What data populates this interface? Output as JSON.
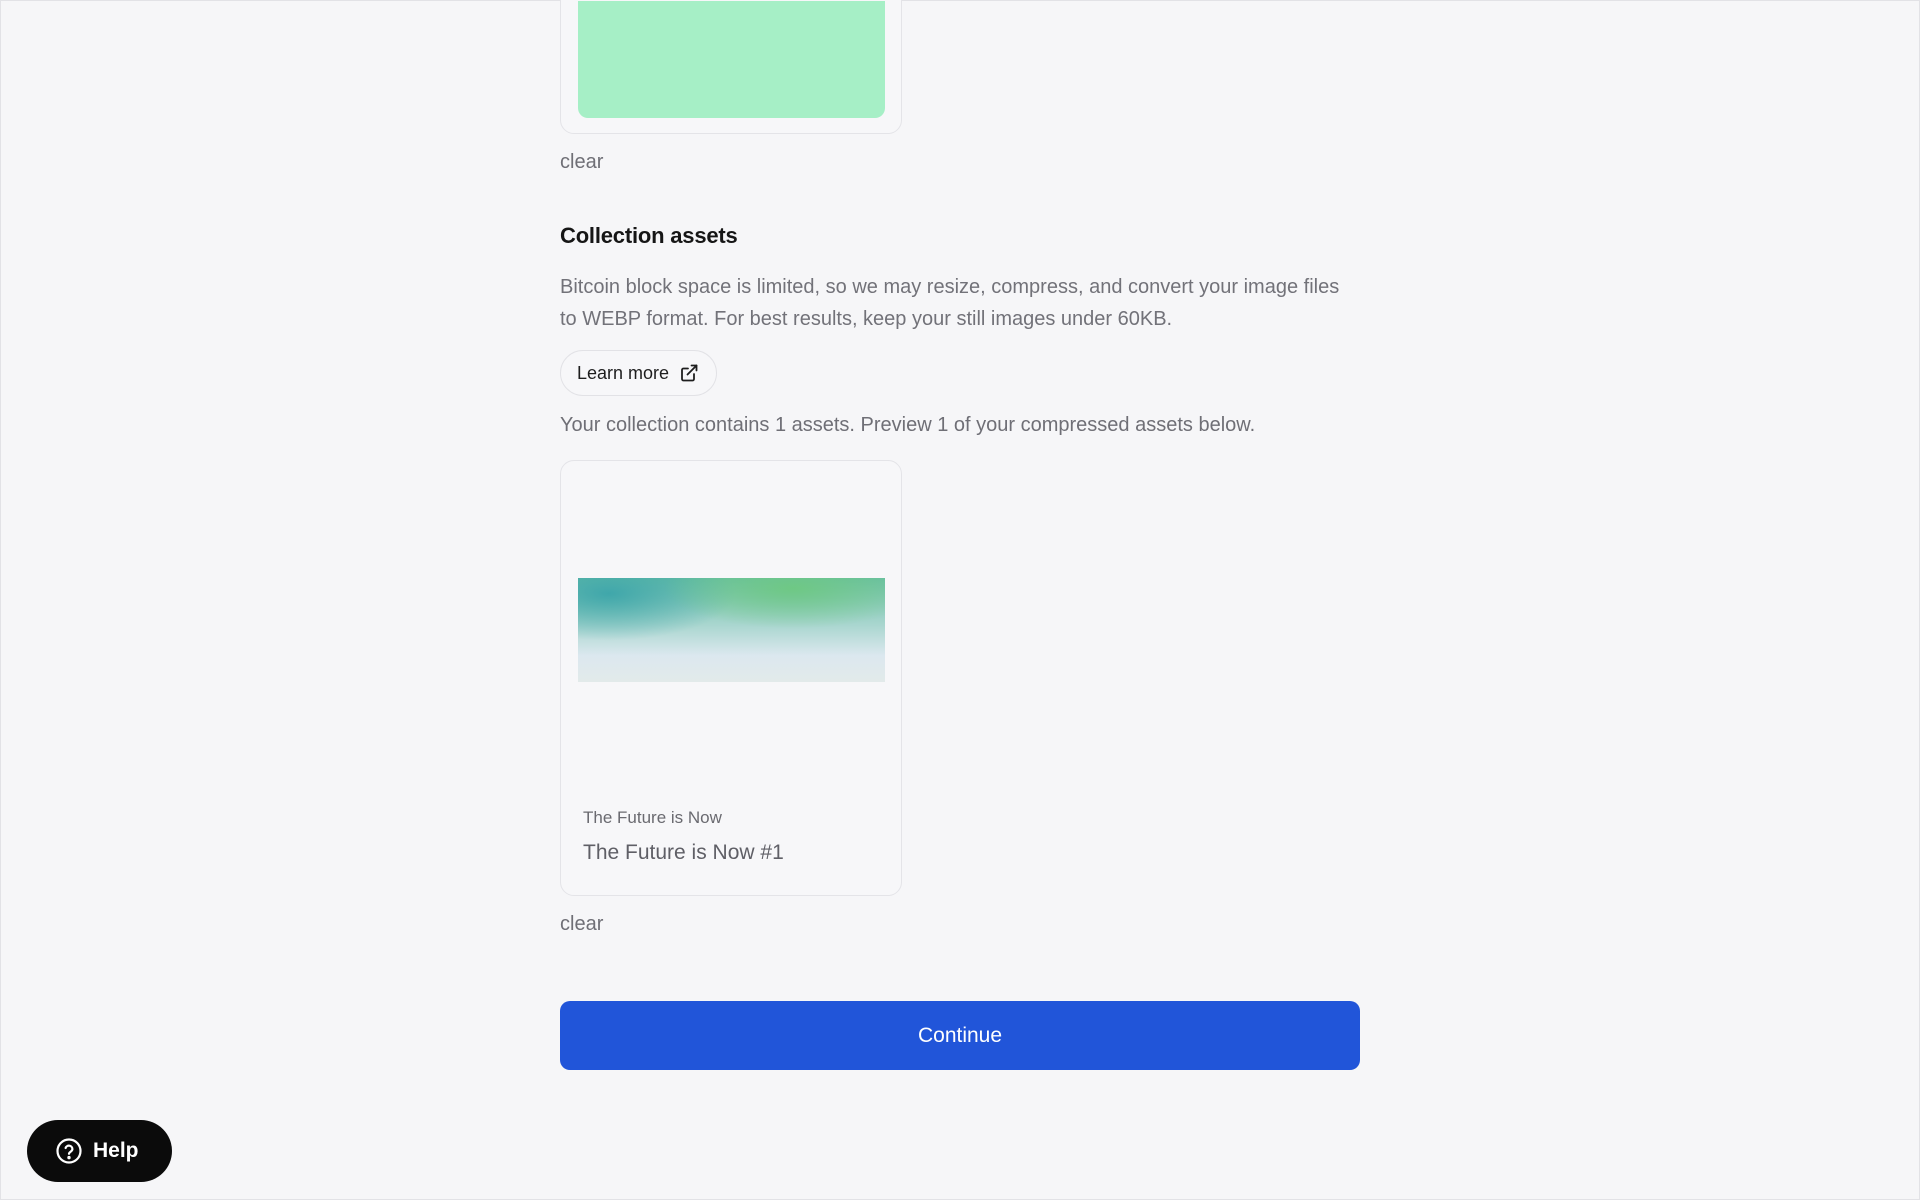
{
  "top_card": {
    "swatch_color": "#a6efc6",
    "clear_label": "clear"
  },
  "collection_assets": {
    "title": "Collection assets",
    "description": "Bitcoin block space is limited, so we may resize, compress, and convert your image files to WEBP format. For best results, keep your still images under 60KB.",
    "learn_more_label": "Learn more",
    "learn_more_icon": "external-link-icon",
    "count_text": "Your collection contains 1 assets. Preview 1 of your compressed assets below."
  },
  "asset": {
    "collection_name": "The Future is Now",
    "item_name": "The Future is Now #1",
    "clear_label": "clear"
  },
  "continue_label": "Continue",
  "help": {
    "label": "Help",
    "icon": "question-circle-icon"
  },
  "colors": {
    "primary": "#2155d9",
    "background": "#f6f6f8",
    "help_bg": "#0b0b0b"
  }
}
